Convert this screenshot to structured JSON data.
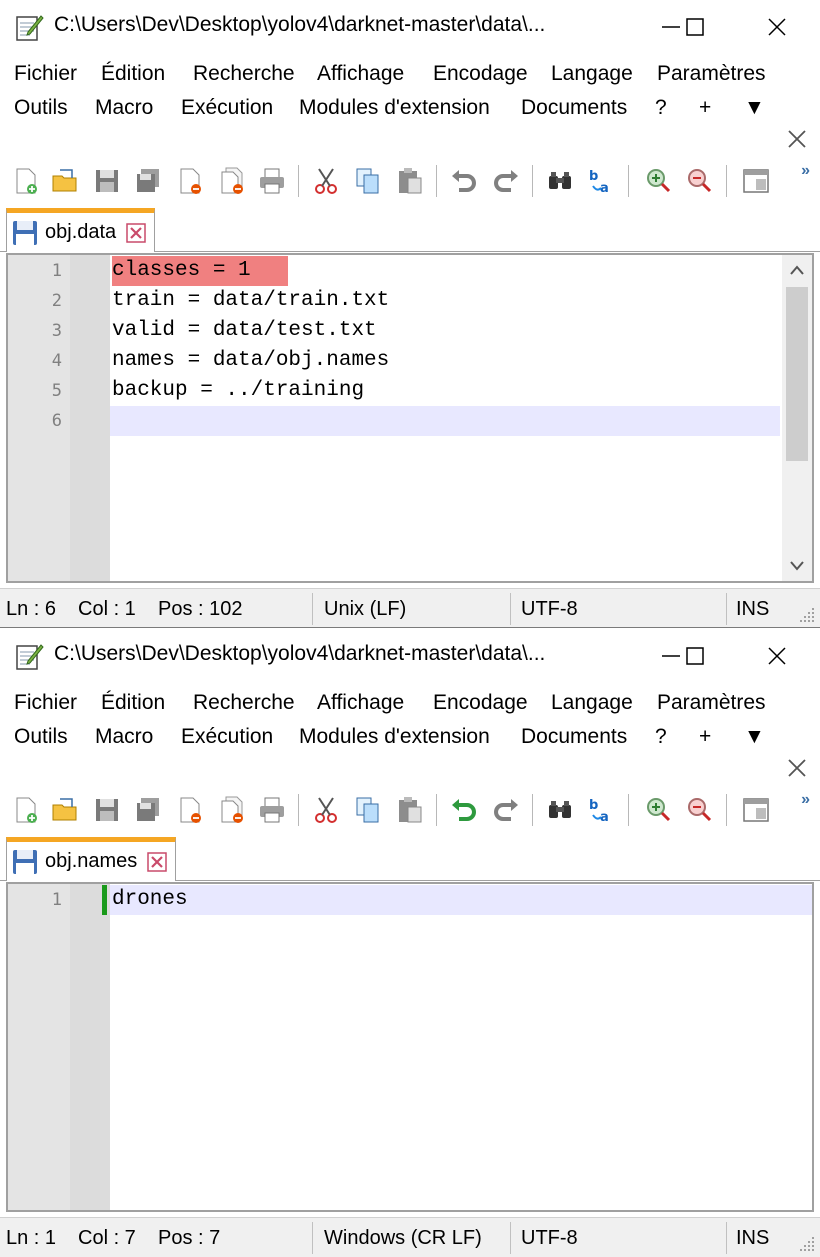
{
  "windows": [
    {
      "title": "C:\\Users\\Dev\\Desktop\\yolov4\\darknet-master\\data\\...",
      "menu_row1": [
        "Fichier",
        "Édition",
        "Recherche",
        "Affichage",
        "Encodage",
        "Langage",
        "Paramètres"
      ],
      "menu_row2": [
        "Outils",
        "Macro",
        "Exécution",
        "Modules d'extension",
        "Documents",
        "?",
        "+",
        "▼"
      ],
      "tab": {
        "label": "obj.data",
        "icon": "floppy-disk-icon"
      },
      "lines": [
        {
          "number": "1",
          "text": "classes = 1"
        },
        {
          "number": "2",
          "text": "train = data/train.txt"
        },
        {
          "number": "3",
          "text": "valid = data/test.txt"
        },
        {
          "number": "4",
          "text": "names = data/obj.names"
        },
        {
          "number": "5",
          "text": "backup = ../training"
        },
        {
          "number": "6",
          "text": ""
        }
      ],
      "status": {
        "ln": "Ln : 6",
        "col": "Col : 1",
        "pos": "Pos : 102",
        "eol": "Unix (LF)",
        "encoding": "UTF-8",
        "mode": "INS"
      }
    },
    {
      "title": "C:\\Users\\Dev\\Desktop\\yolov4\\darknet-master\\data\\...",
      "menu_row1": [
        "Fichier",
        "Édition",
        "Recherche",
        "Affichage",
        "Encodage",
        "Langage",
        "Paramètres"
      ],
      "menu_row2": [
        "Outils",
        "Macro",
        "Exécution",
        "Modules d'extension",
        "Documents",
        "?",
        "+",
        "▼"
      ],
      "tab": {
        "label": "obj.names",
        "icon": "floppy-disk-icon"
      },
      "lines": [
        {
          "number": "1",
          "text": "drones"
        }
      ],
      "status": {
        "ln": "Ln : 1",
        "col": "Col : 7",
        "pos": "Pos : 7",
        "eol": "Windows (CR LF)",
        "encoding": "UTF-8",
        "mode": "INS"
      }
    }
  ],
  "colors": {
    "tab_accent": "#f5a623",
    "current_line": "#e8e8ff",
    "search_highlight": "#f08080",
    "change_marker": "#1a9a1a"
  },
  "icons": [
    "notepad-app-icon",
    "minimize-icon",
    "maximize-icon",
    "close-icon",
    "new-file-icon",
    "open-file-icon",
    "save-icon",
    "save-all-icon",
    "close-file-icon",
    "close-all-icon",
    "print-icon",
    "cut-icon",
    "copy-icon",
    "paste-icon",
    "undo-icon",
    "redo-icon",
    "find-icon",
    "replace-icon",
    "zoom-in-icon",
    "zoom-out-icon",
    "sync-scroll-icon"
  ]
}
